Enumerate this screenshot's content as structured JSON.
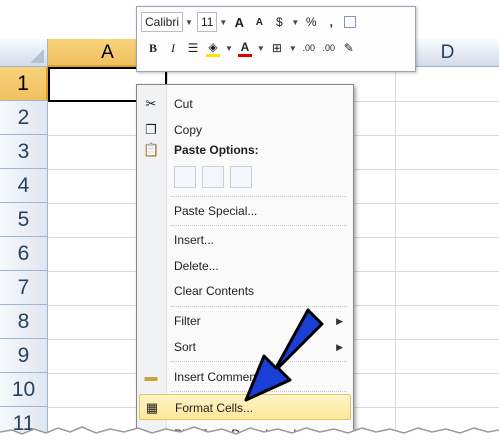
{
  "columns": [
    {
      "label": "A",
      "selected": true
    },
    {
      "label": "D",
      "selected": false
    }
  ],
  "rows": [
    "1",
    "2",
    "3",
    "4",
    "5",
    "6",
    "7",
    "8",
    "9",
    "10",
    "11"
  ],
  "mini_toolbar": {
    "font_name": "Calibri",
    "font_size": "11",
    "grow_font": "A",
    "shrink_font": "A",
    "currency": "$",
    "percent": "%",
    "comma": ",",
    "bold": "B",
    "italic": "I",
    "font_color": "A",
    "increase_decimal": ".00",
    "decrease_decimal": ".00"
  },
  "context_menu": {
    "cut": "Cut",
    "copy": "Copy",
    "paste_options": "Paste Options:",
    "paste_special": "Paste Special...",
    "insert": "Insert...",
    "delete": "Delete...",
    "clear_contents": "Clear Contents",
    "filter": "Filter",
    "sort": "Sort",
    "insert_comment": "Insert Comment",
    "format_cells": "Format Cells...",
    "pick_from_list": "Pick From Drop-down List..."
  },
  "colors": {
    "highlight": "#fde89a",
    "arrow": "#1a3fd6",
    "header_selected": "#f1c15f"
  }
}
